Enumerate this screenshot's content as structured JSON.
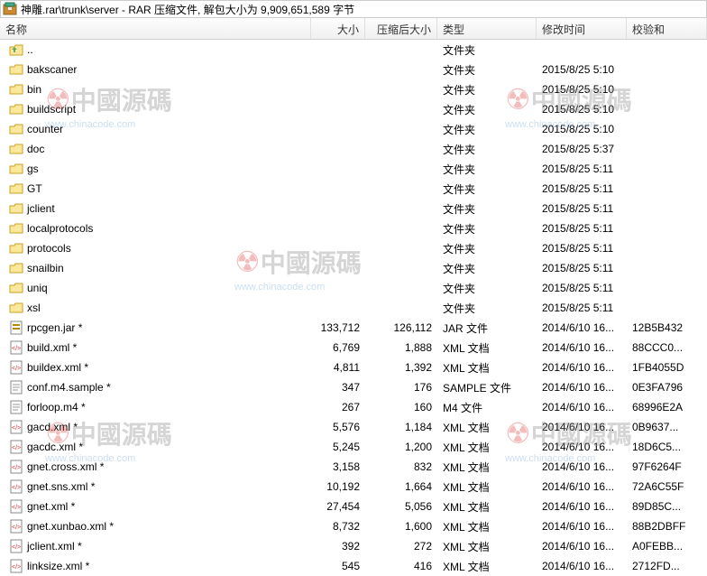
{
  "titlebar": {
    "path": "神雕.rar\\trunk\\server - RAR 压缩文件, 解包大小为 9,909,651,589 字节"
  },
  "columns": {
    "name": "名称",
    "size": "大小",
    "packed": "压缩后大小",
    "type": "类型",
    "date": "修改时间",
    "crc": "校验和"
  },
  "rows": [
    {
      "icon": "up",
      "name": "..",
      "size": "",
      "packed": "",
      "type": "文件夹",
      "date": "",
      "crc": ""
    },
    {
      "icon": "folder",
      "name": "bakscaner",
      "size": "",
      "packed": "",
      "type": "文件夹",
      "date": "2015/8/25 5:10",
      "crc": ""
    },
    {
      "icon": "folder",
      "name": "bin",
      "size": "",
      "packed": "",
      "type": "文件夹",
      "date": "2015/8/25 5:10",
      "crc": ""
    },
    {
      "icon": "folder",
      "name": "buildscript",
      "size": "",
      "packed": "",
      "type": "文件夹",
      "date": "2015/8/25 5:10",
      "crc": ""
    },
    {
      "icon": "folder",
      "name": "counter",
      "size": "",
      "packed": "",
      "type": "文件夹",
      "date": "2015/8/25 5:10",
      "crc": ""
    },
    {
      "icon": "folder",
      "name": "doc",
      "size": "",
      "packed": "",
      "type": "文件夹",
      "date": "2015/8/25 5:37",
      "crc": ""
    },
    {
      "icon": "folder",
      "name": "gs",
      "size": "",
      "packed": "",
      "type": "文件夹",
      "date": "2015/8/25 5:11",
      "crc": ""
    },
    {
      "icon": "folder",
      "name": "GT",
      "size": "",
      "packed": "",
      "type": "文件夹",
      "date": "2015/8/25 5:11",
      "crc": ""
    },
    {
      "icon": "folder",
      "name": "jclient",
      "size": "",
      "packed": "",
      "type": "文件夹",
      "date": "2015/8/25 5:11",
      "crc": ""
    },
    {
      "icon": "folder",
      "name": "localprotocols",
      "size": "",
      "packed": "",
      "type": "文件夹",
      "date": "2015/8/25 5:11",
      "crc": ""
    },
    {
      "icon": "folder",
      "name": "protocols",
      "size": "",
      "packed": "",
      "type": "文件夹",
      "date": "2015/8/25 5:11",
      "crc": ""
    },
    {
      "icon": "folder",
      "name": "snailbin",
      "size": "",
      "packed": "",
      "type": "文件夹",
      "date": "2015/8/25 5:11",
      "crc": ""
    },
    {
      "icon": "folder",
      "name": "uniq",
      "size": "",
      "packed": "",
      "type": "文件夹",
      "date": "2015/8/25 5:11",
      "crc": ""
    },
    {
      "icon": "folder",
      "name": "xsl",
      "size": "",
      "packed": "",
      "type": "文件夹",
      "date": "2015/8/25 5:11",
      "crc": ""
    },
    {
      "icon": "jar",
      "name": "rpcgen.jar *",
      "size": "133,712",
      "packed": "126,112",
      "type": "JAR 文件",
      "date": "2014/6/10 16...",
      "crc": "12B5B432"
    },
    {
      "icon": "xml",
      "name": "build.xml *",
      "size": "6,769",
      "packed": "1,888",
      "type": "XML 文档",
      "date": "2014/6/10 16...",
      "crc": "88CCC0..."
    },
    {
      "icon": "xml",
      "name": "buildex.xml *",
      "size": "4,811",
      "packed": "1,392",
      "type": "XML 文档",
      "date": "2014/6/10 16...",
      "crc": "1FB4055D"
    },
    {
      "icon": "file",
      "name": "conf.m4.sample *",
      "size": "347",
      "packed": "176",
      "type": "SAMPLE 文件",
      "date": "2014/6/10 16...",
      "crc": "0E3FA796"
    },
    {
      "icon": "file",
      "name": "forloop.m4 *",
      "size": "267",
      "packed": "160",
      "type": "M4 文件",
      "date": "2014/6/10 16...",
      "crc": "68996E2A"
    },
    {
      "icon": "xml",
      "name": "gacd.xml *",
      "size": "5,576",
      "packed": "1,184",
      "type": "XML 文档",
      "date": "2014/6/10 16...",
      "crc": "0B9637..."
    },
    {
      "icon": "xml",
      "name": "gacdc.xml *",
      "size": "5,245",
      "packed": "1,200",
      "type": "XML 文档",
      "date": "2014/6/10 16...",
      "crc": "18D6C5..."
    },
    {
      "icon": "xml",
      "name": "gnet.cross.xml *",
      "size": "3,158",
      "packed": "832",
      "type": "XML 文档",
      "date": "2014/6/10 16...",
      "crc": "97F6264F"
    },
    {
      "icon": "xml",
      "name": "gnet.sns.xml *",
      "size": "10,192",
      "packed": "1,664",
      "type": "XML 文档",
      "date": "2014/6/10 16...",
      "crc": "72A6C55F"
    },
    {
      "icon": "xml",
      "name": "gnet.xml *",
      "size": "27,454",
      "packed": "5,056",
      "type": "XML 文档",
      "date": "2014/6/10 16...",
      "crc": "89D85C..."
    },
    {
      "icon": "xml",
      "name": "gnet.xunbao.xml *",
      "size": "8,732",
      "packed": "1,600",
      "type": "XML 文档",
      "date": "2014/6/10 16...",
      "crc": "88B2DBFF"
    },
    {
      "icon": "xml",
      "name": "jclient.xml *",
      "size": "392",
      "packed": "272",
      "type": "XML 文档",
      "date": "2014/6/10 16...",
      "crc": "A0FEBB..."
    },
    {
      "icon": "xml",
      "name": "linksize.xml *",
      "size": "545",
      "packed": "416",
      "type": "XML 文档",
      "date": "2014/6/10 16...",
      "crc": "2712FD..."
    }
  ],
  "watermark": {
    "text": "中國源碼",
    "url": "www.chinacode.com"
  }
}
